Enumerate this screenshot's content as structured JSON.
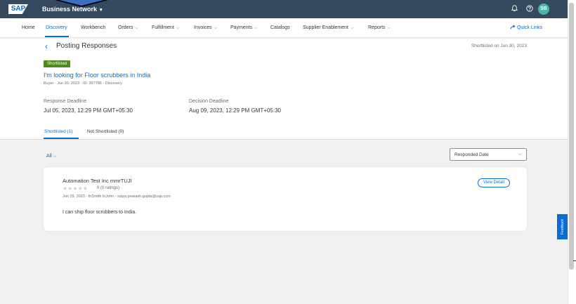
{
  "shellbar": {
    "logo": "SAP",
    "brand": "Business Network",
    "brand_chevron": "▾",
    "notification_icon": "bell-icon",
    "help_icon": "help-icon",
    "avatar_initials": "SB"
  },
  "nav": {
    "items": [
      {
        "label": "Home",
        "has_menu": false
      },
      {
        "label": "Discovery",
        "has_menu": false
      },
      {
        "label": "Workbench",
        "has_menu": false
      },
      {
        "label": "Orders",
        "has_menu": true
      },
      {
        "label": "Fulfillment",
        "has_menu": true
      },
      {
        "label": "Invoices",
        "has_menu": true
      },
      {
        "label": "Payments",
        "has_menu": true
      },
      {
        "label": "Catalogs",
        "has_menu": false
      },
      {
        "label": "Supplier Enablement",
        "has_menu": true
      },
      {
        "label": "Reports",
        "has_menu": true
      }
    ],
    "active": "Discovery",
    "quick_links": "Quick Links"
  },
  "header": {
    "back_icon": "‹",
    "title": "Posting Responses",
    "shortlisted_on": "Shortlisted on Jun 30, 2023",
    "badge": "Shortlisted",
    "posting_title": "I'm looking for Floor scrubbers in India",
    "posting_meta": "Buyer  ·  Jun 30, 2023  ·  ID: 367786  ·  Discovery",
    "response_deadline_label": "Response Deadline",
    "response_deadline_value": "Jul 05, 2023, 12:29 PM GMT+05:30",
    "decision_deadline_label": "Decision Deadline",
    "decision_deadline_value": "Aug 09, 2023, 12:29 PM GMT+05:30"
  },
  "tabs": {
    "shortlisted": "Shortlisted (1)",
    "not_shortlisted": "Not Shortlisted (0)"
  },
  "filters": {
    "all": "All",
    "sort_value": "Responded Date"
  },
  "response": {
    "supplier": "Automation Test Inc mmrTUJI",
    "stars": "★★★★★",
    "rating_text": "0 (0 ratings)",
    "meta": "Jun 29, 2023  ·  fnSmith lnJohn  ·  satya.prakash.gupta@sap.com",
    "message": "I can ship floor scrubbers to India.",
    "view_detail": "View Detail"
  },
  "feedback": "Feedback",
  "colors": {
    "shellbar": "#354a5f",
    "accent": "#0a6ed1",
    "badge": "#4c8a1a",
    "avatar": "#4ab8a8"
  }
}
